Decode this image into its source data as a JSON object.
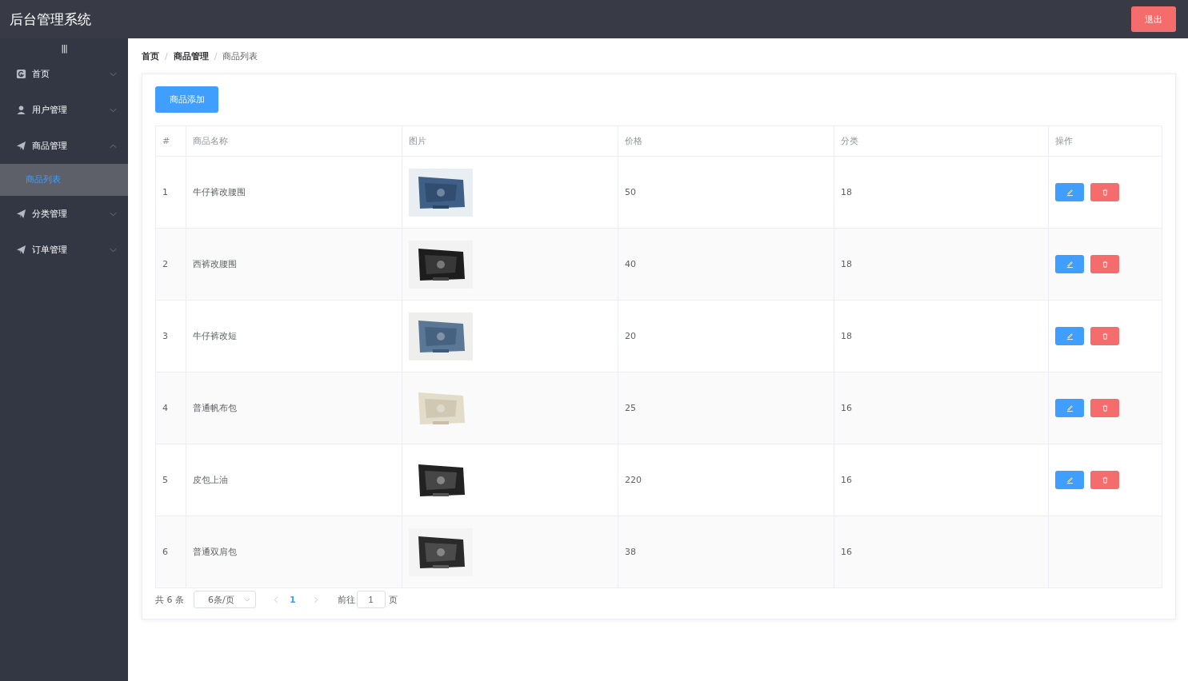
{
  "header": {
    "title": "后台管理系统",
    "logout": "退出"
  },
  "sidebar": {
    "toggle": "|||",
    "items": [
      {
        "label": "首页",
        "expanded": false
      },
      {
        "label": "用户管理",
        "expanded": false
      },
      {
        "label": "商品管理",
        "expanded": true,
        "children": [
          {
            "label": "商品列表",
            "selected": true
          }
        ]
      },
      {
        "label": "分类管理",
        "expanded": false
      },
      {
        "label": "订单管理",
        "expanded": false
      }
    ]
  },
  "breadcrumb_separator": "/",
  "breadcrumb": [
    {
      "label": "首页",
      "current": false
    },
    {
      "label": "商品管理",
      "current": false
    },
    {
      "label": "商品列表",
      "current": true
    }
  ],
  "add_button": "商品添加",
  "table": {
    "columns": [
      "#",
      "商品名称",
      "图片",
      "价格",
      "分类",
      "操作"
    ],
    "rows": [
      {
        "index": "1",
        "name": "牛仔裤改腰围",
        "price": "50",
        "category": "18",
        "actions": true
      },
      {
        "index": "2",
        "name": "西裤改腰围",
        "price": "40",
        "category": "18",
        "actions": true
      },
      {
        "index": "3",
        "name": "牛仔裤改短",
        "price": "20",
        "category": "18",
        "actions": true
      },
      {
        "index": "4",
        "name": "普通帆布包",
        "price": "25",
        "category": "16",
        "actions": true
      },
      {
        "index": "5",
        "name": "皮包上油",
        "price": "220",
        "category": "16",
        "actions": true
      },
      {
        "index": "6",
        "name": "普通双肩包",
        "price": "38",
        "category": "16",
        "actions": false
      }
    ]
  },
  "pagination": {
    "total": "共 6 条",
    "page_size": "6条/页",
    "pages": [
      {
        "label": "1",
        "selected": true
      }
    ],
    "jump_label": "前往",
    "jump_value": "1",
    "jump_suffix": "页"
  }
}
